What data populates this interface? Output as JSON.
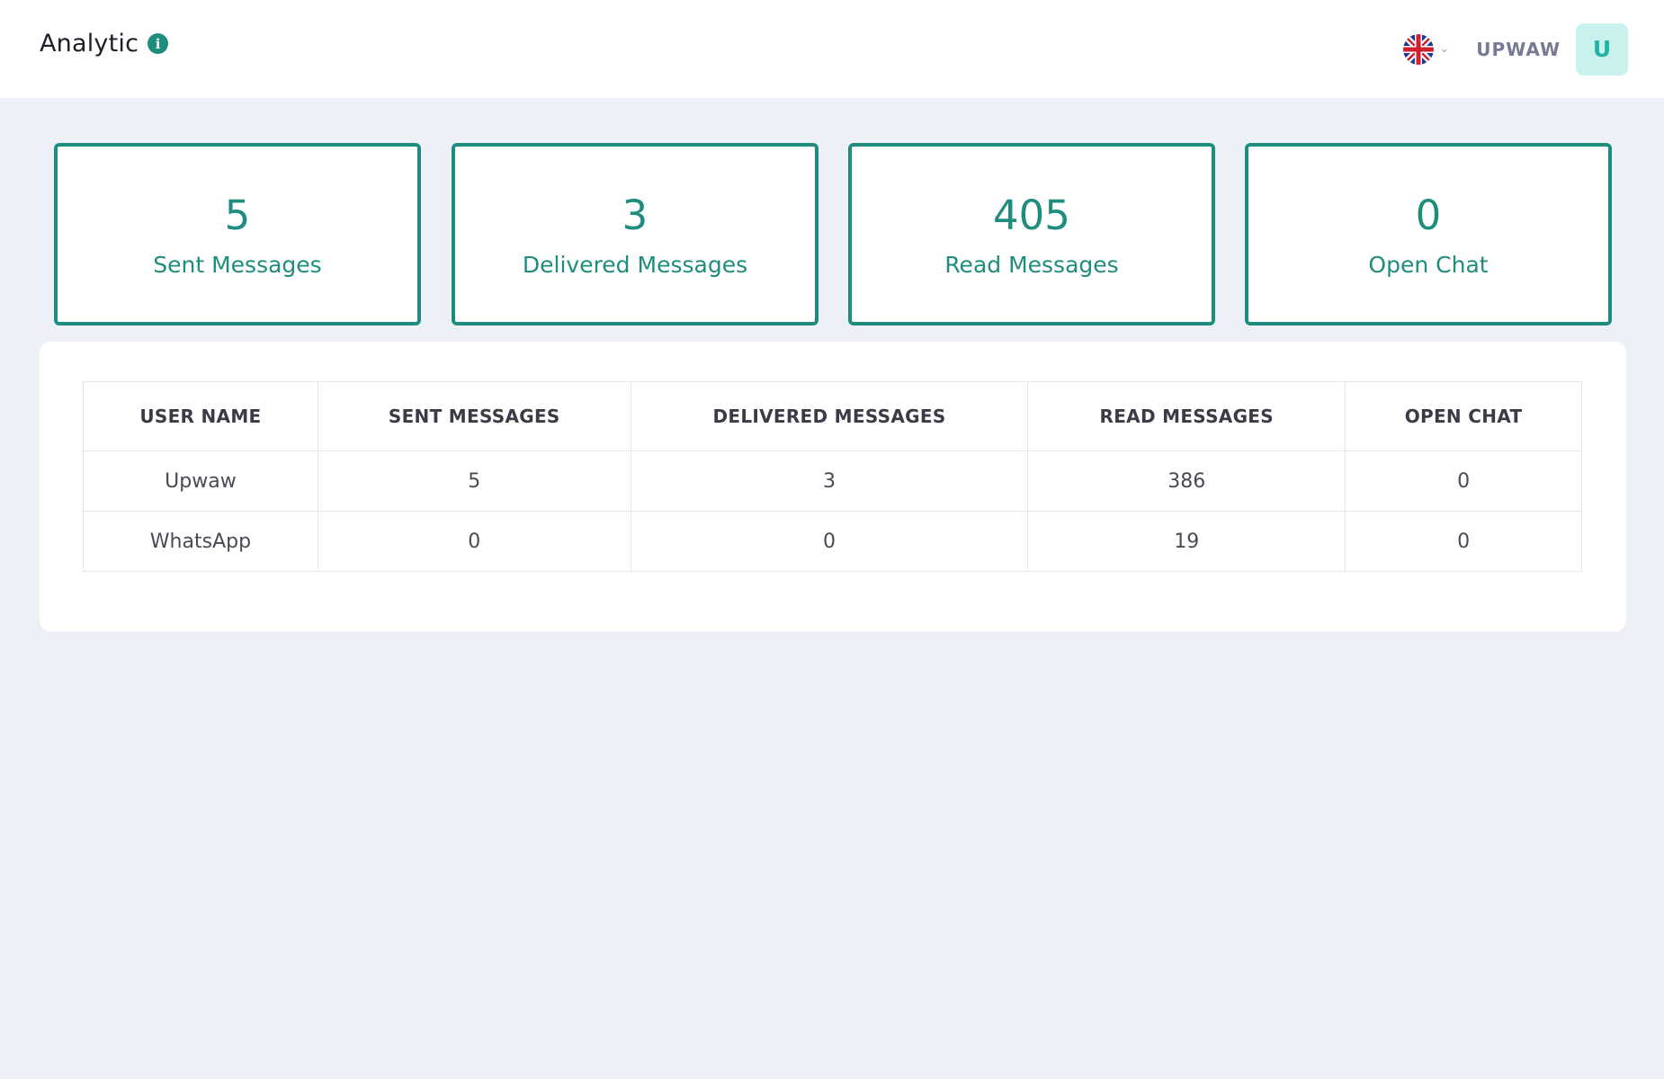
{
  "header": {
    "title": "Analytic",
    "username": "UPWAW",
    "avatar_initial": "U"
  },
  "stats": [
    {
      "value": "5",
      "label": "Sent Messages"
    },
    {
      "value": "3",
      "label": "Delivered Messages"
    },
    {
      "value": "405",
      "label": "Read Messages"
    },
    {
      "value": "0",
      "label": "Open Chat"
    }
  ],
  "table": {
    "headers": [
      "USER NAME",
      "SENT MESSAGES",
      "DELIVERED MESSAGES",
      "READ MESSAGES",
      "OPEN CHAT"
    ],
    "rows": [
      [
        "Upwaw",
        "5",
        "3",
        "386",
        "0"
      ],
      [
        "WhatsApp",
        "0",
        "0",
        "19",
        "0"
      ]
    ]
  },
  "colors": {
    "accent": "#1f8d7e",
    "background": "#eef0f8",
    "avatar_bg": "#c9f1ee"
  },
  "icons": [
    "info-icon",
    "uk-flag-icon",
    "chevron-down-icon"
  ]
}
